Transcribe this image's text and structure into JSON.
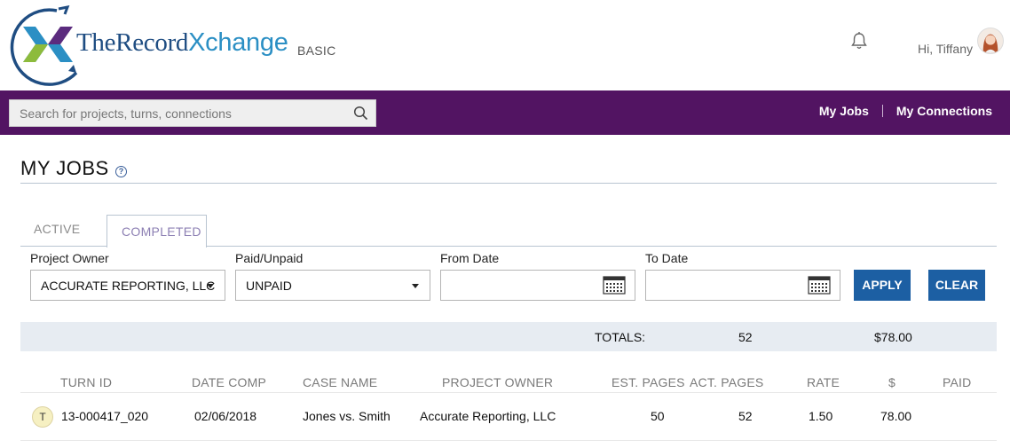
{
  "brand": {
    "name_part1": "TheRecord",
    "name_part2": "Xchange",
    "plan": "BASIC",
    "colors": {
      "navy": "#1f4d82",
      "blue": "#2b8fc4",
      "green": "#8dbb3c",
      "purple": "#5b2b7e"
    }
  },
  "header": {
    "notification_icon": "bell-icon",
    "greeting": "Hi, Tiffany"
  },
  "nav": {
    "search_placeholder": "Search for projects, turns, connections",
    "search_icon": "search-icon",
    "links": [
      "My Jobs",
      "My Connections"
    ],
    "bg_color": "#521462"
  },
  "page": {
    "title": "MY JOBS",
    "help_icon": "?"
  },
  "tabs": [
    {
      "label": "ACTIVE",
      "selected": false
    },
    {
      "label": "COMPLETED",
      "selected": true
    }
  ],
  "filters": {
    "project_owner": {
      "label": "Project Owner",
      "value": "ACCURATE REPORTING, LLC"
    },
    "paid_unpaid": {
      "label": "Paid/Unpaid",
      "value": "UNPAID"
    },
    "from_date": {
      "label": "From Date",
      "value": ""
    },
    "to_date": {
      "label": "To Date",
      "value": ""
    },
    "apply_label": "APPLY",
    "clear_label": "CLEAR",
    "button_color": "#1c5fa3"
  },
  "totals": {
    "label": "TOTALS:",
    "pages": "52",
    "amount": "$78.00"
  },
  "table": {
    "columns": [
      "TURN ID",
      "DATE COMP",
      "CASE NAME",
      "PROJECT OWNER",
      "EST. PAGES",
      "ACT. PAGES",
      "RATE",
      "$",
      "PAID"
    ],
    "rows": [
      {
        "type_badge": "T",
        "turn_id": "13-000417_020",
        "date_comp": "02/06/2018",
        "case_name": "Jones vs. Smith",
        "project_owner": "Accurate Reporting, LLC",
        "est_pages": "50",
        "act_pages": "52",
        "rate": "1.50",
        "amount": "78.00",
        "paid": ""
      }
    ]
  }
}
